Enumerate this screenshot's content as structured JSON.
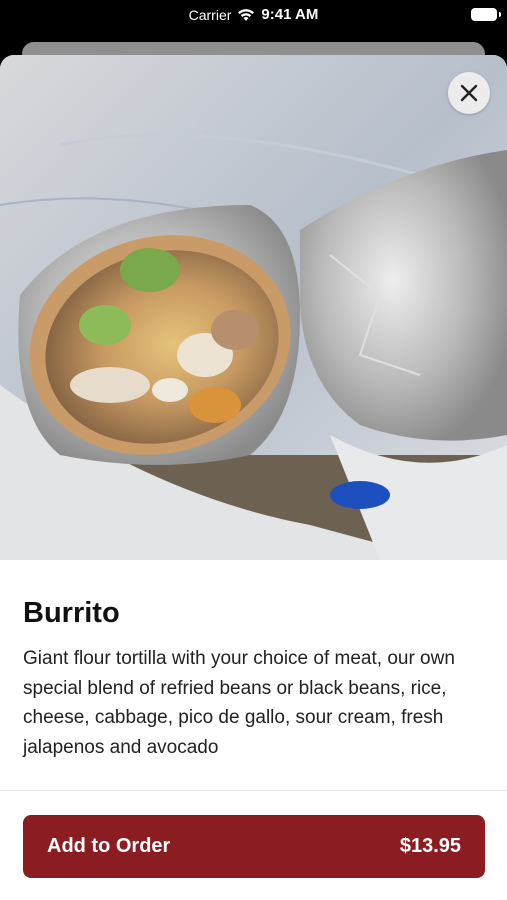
{
  "status_bar": {
    "carrier": "Carrier",
    "time": "9:41 AM"
  },
  "item": {
    "title": "Burrito",
    "description": "Giant flour tortilla with your choice of meat, our own special blend of refried beans or black beans, rice, cheese, cabbage, pico de gallo, sour cream, fresh jalapenos and avocado",
    "image_icon": "burrito-photo"
  },
  "close": {
    "icon": "close-icon"
  },
  "order_button": {
    "label": "Add to Order",
    "price": "$13.95",
    "color": "#8b1c22"
  }
}
